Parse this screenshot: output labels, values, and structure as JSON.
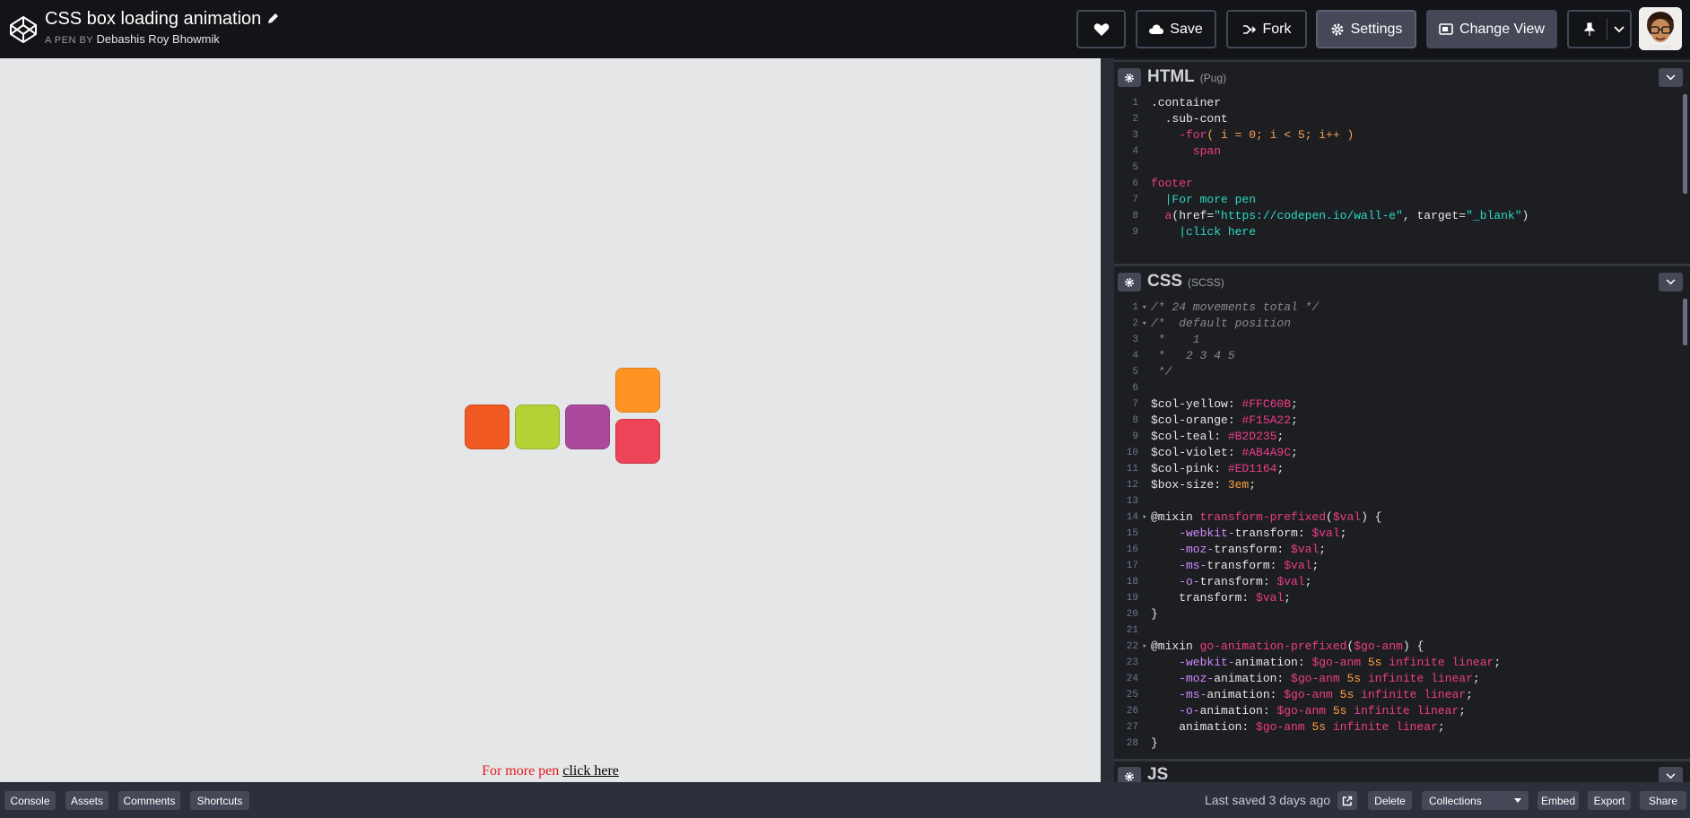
{
  "header": {
    "pen_title": "CSS box loading animation",
    "by_prefix": "A PEN BY",
    "author": "Debashis Roy Bhowmik",
    "buttons": {
      "save": "Save",
      "fork": "Fork",
      "settings": "Settings",
      "change_view": "Change View"
    }
  },
  "preview": {
    "footer_text": "For more pen",
    "footer_link": "click here",
    "box_colors": [
      "#F15A22",
      "#B2D235",
      "#AB4A9C",
      "#FF9422",
      "#ED4457"
    ]
  },
  "editors": {
    "html": {
      "title": "HTML",
      "lang": "(Pug)",
      "lines": [
        {
          "n": "1",
          "parts": [
            {
              "c": "c-plain",
              "t": ".container"
            }
          ]
        },
        {
          "n": "2",
          "parts": [
            {
              "c": "c-plain",
              "t": "  .sub-cont"
            }
          ]
        },
        {
          "n": "3",
          "parts": [
            {
              "c": "c-tag",
              "t": "    -for"
            },
            {
              "c": "c-kw",
              "t": "( i = 0; i < 5; i++ )"
            }
          ]
        },
        {
          "n": "4",
          "parts": [
            {
              "c": "c-tag",
              "t": "      span"
            }
          ]
        },
        {
          "n": "5",
          "parts": [
            {
              "c": "c-plain",
              "t": ""
            }
          ]
        },
        {
          "n": "6",
          "parts": [
            {
              "c": "c-tag",
              "t": "footer"
            }
          ]
        },
        {
          "n": "7",
          "parts": [
            {
              "c": "c-teal",
              "t": "  |For more pen"
            }
          ]
        },
        {
          "n": "8",
          "parts": [
            {
              "c": "c-tag",
              "t": "  a"
            },
            {
              "c": "c-plain",
              "t": "("
            },
            {
              "c": "c-plain",
              "t": "href="
            },
            {
              "c": "c-teal",
              "t": "\"https://codepen.io/wall-e\""
            },
            {
              "c": "c-plain",
              "t": ", target="
            },
            {
              "c": "c-teal",
              "t": "\"_blank\""
            },
            {
              "c": "c-plain",
              "t": ")"
            }
          ]
        },
        {
          "n": "9",
          "parts": [
            {
              "c": "c-teal",
              "t": "    |click here"
            }
          ]
        }
      ]
    },
    "css": {
      "title": "CSS",
      "lang": "(SCSS)",
      "lines": [
        {
          "n": "1",
          "fold": "▾",
          "parts": [
            {
              "c": "c-comm",
              "t": "/* 24 movements total */"
            }
          ]
        },
        {
          "n": "2",
          "fold": "▾",
          "parts": [
            {
              "c": "c-comm",
              "t": "/*  default position"
            }
          ]
        },
        {
          "n": "3",
          "parts": [
            {
              "c": "c-comm",
              "t": " *    1"
            }
          ]
        },
        {
          "n": "4",
          "parts": [
            {
              "c": "c-comm",
              "t": " *   2 3 4 5"
            }
          ]
        },
        {
          "n": "5",
          "parts": [
            {
              "c": "c-comm",
              "t": " */"
            }
          ]
        },
        {
          "n": "6",
          "parts": [
            {
              "c": "c-plain",
              "t": ""
            }
          ]
        },
        {
          "n": "7",
          "parts": [
            {
              "c": "c-var",
              "t": "$col-yellow: "
            },
            {
              "c": "c-hex",
              "t": "#FFC60B"
            },
            {
              "c": "c-plain",
              "t": ";"
            }
          ]
        },
        {
          "n": "8",
          "parts": [
            {
              "c": "c-var",
              "t": "$col-orange: "
            },
            {
              "c": "c-hex",
              "t": "#F15A22"
            },
            {
              "c": "c-plain",
              "t": ";"
            }
          ]
        },
        {
          "n": "9",
          "parts": [
            {
              "c": "c-var",
              "t": "$col-teal: "
            },
            {
              "c": "c-hex",
              "t": "#B2D235"
            },
            {
              "c": "c-plain",
              "t": ";"
            }
          ]
        },
        {
          "n": "10",
          "parts": [
            {
              "c": "c-var",
              "t": "$col-violet: "
            },
            {
              "c": "c-hex",
              "t": "#AB4A9C"
            },
            {
              "c": "c-plain",
              "t": ";"
            }
          ]
        },
        {
          "n": "11",
          "parts": [
            {
              "c": "c-var",
              "t": "$col-pink: "
            },
            {
              "c": "c-hex",
              "t": "#ED1164"
            },
            {
              "c": "c-plain",
              "t": ";"
            }
          ]
        },
        {
          "n": "12",
          "parts": [
            {
              "c": "c-var",
              "t": "$box-size: "
            },
            {
              "c": "c-num",
              "t": "3em"
            },
            {
              "c": "c-plain",
              "t": ";"
            }
          ]
        },
        {
          "n": "13",
          "parts": [
            {
              "c": "c-plain",
              "t": ""
            }
          ]
        },
        {
          "n": "14",
          "fold": "▾",
          "parts": [
            {
              "c": "c-at",
              "t": "@mixin "
            },
            {
              "c": "c-fn",
              "t": "transform-prefixed"
            },
            {
              "c": "c-plain",
              "t": "("
            },
            {
              "c": "c-hex",
              "t": "$val"
            },
            {
              "c": "c-plain",
              "t": ") {"
            }
          ]
        },
        {
          "n": "15",
          "parts": [
            {
              "c": "c-pre",
              "t": "    -webkit-"
            },
            {
              "c": "c-prop",
              "t": "transform: "
            },
            {
              "c": "c-hex",
              "t": "$val"
            },
            {
              "c": "c-plain",
              "t": ";"
            }
          ]
        },
        {
          "n": "16",
          "parts": [
            {
              "c": "c-pre",
              "t": "    -moz-"
            },
            {
              "c": "c-prop",
              "t": "transform: "
            },
            {
              "c": "c-hex",
              "t": "$val"
            },
            {
              "c": "c-plain",
              "t": ";"
            }
          ]
        },
        {
          "n": "17",
          "parts": [
            {
              "c": "c-pre",
              "t": "    -ms-"
            },
            {
              "c": "c-prop",
              "t": "transform: "
            },
            {
              "c": "c-hex",
              "t": "$val"
            },
            {
              "c": "c-plain",
              "t": ";"
            }
          ]
        },
        {
          "n": "18",
          "parts": [
            {
              "c": "c-pre",
              "t": "    -o-"
            },
            {
              "c": "c-prop",
              "t": "transform: "
            },
            {
              "c": "c-hex",
              "t": "$val"
            },
            {
              "c": "c-plain",
              "t": ";"
            }
          ]
        },
        {
          "n": "19",
          "parts": [
            {
              "c": "c-prop",
              "t": "    transform: "
            },
            {
              "c": "c-hex",
              "t": "$val"
            },
            {
              "c": "c-plain",
              "t": ";"
            }
          ]
        },
        {
          "n": "20",
          "parts": [
            {
              "c": "c-plain",
              "t": "}"
            }
          ]
        },
        {
          "n": "21",
          "parts": [
            {
              "c": "c-plain",
              "t": ""
            }
          ]
        },
        {
          "n": "22",
          "fold": "▾",
          "parts": [
            {
              "c": "c-at",
              "t": "@mixin "
            },
            {
              "c": "c-fn",
              "t": "go-animation-prefixed"
            },
            {
              "c": "c-plain",
              "t": "("
            },
            {
              "c": "c-hex",
              "t": "$go-anm"
            },
            {
              "c": "c-plain",
              "t": ") {"
            }
          ]
        },
        {
          "n": "23",
          "parts": [
            {
              "c": "c-pre",
              "t": "    -webkit-"
            },
            {
              "c": "c-prop",
              "t": "animation: "
            },
            {
              "c": "c-hex",
              "t": "$go-anm "
            },
            {
              "c": "c-num",
              "t": "5s "
            },
            {
              "c": "c-fn",
              "t": "infinite linear"
            },
            {
              "c": "c-plain",
              "t": ";"
            }
          ]
        },
        {
          "n": "24",
          "parts": [
            {
              "c": "c-pre",
              "t": "    -moz-"
            },
            {
              "c": "c-prop",
              "t": "animation: "
            },
            {
              "c": "c-hex",
              "t": "$go-anm "
            },
            {
              "c": "c-num",
              "t": "5s "
            },
            {
              "c": "c-fn",
              "t": "infinite linear"
            },
            {
              "c": "c-plain",
              "t": ";"
            }
          ]
        },
        {
          "n": "25",
          "parts": [
            {
              "c": "c-pre",
              "t": "    -ms-"
            },
            {
              "c": "c-prop",
              "t": "animation: "
            },
            {
              "c": "c-hex",
              "t": "$go-anm "
            },
            {
              "c": "c-num",
              "t": "5s "
            },
            {
              "c": "c-fn",
              "t": "infinite linear"
            },
            {
              "c": "c-plain",
              "t": ";"
            }
          ]
        },
        {
          "n": "26",
          "parts": [
            {
              "c": "c-pre",
              "t": "    -o-"
            },
            {
              "c": "c-prop",
              "t": "animation: "
            },
            {
              "c": "c-hex",
              "t": "$go-anm "
            },
            {
              "c": "c-num",
              "t": "5s "
            },
            {
              "c": "c-fn",
              "t": "infinite linear"
            },
            {
              "c": "c-plain",
              "t": ";"
            }
          ]
        },
        {
          "n": "27",
          "parts": [
            {
              "c": "c-prop",
              "t": "    animation: "
            },
            {
              "c": "c-hex",
              "t": "$go-anm "
            },
            {
              "c": "c-num",
              "t": "5s "
            },
            {
              "c": "c-fn",
              "t": "infinite linear"
            },
            {
              "c": "c-plain",
              "t": ";"
            }
          ]
        },
        {
          "n": "28",
          "parts": [
            {
              "c": "c-plain",
              "t": "}"
            }
          ]
        }
      ]
    },
    "js": {
      "title": "JS"
    }
  },
  "bottom_bar": {
    "console": "Console",
    "assets": "Assets",
    "comments": "Comments",
    "shortcuts": "Shortcuts",
    "last_saved": "Last saved 3 days ago",
    "delete": "Delete",
    "collections": "Collections",
    "embed": "Embed",
    "export": "Export",
    "share": "Share"
  }
}
